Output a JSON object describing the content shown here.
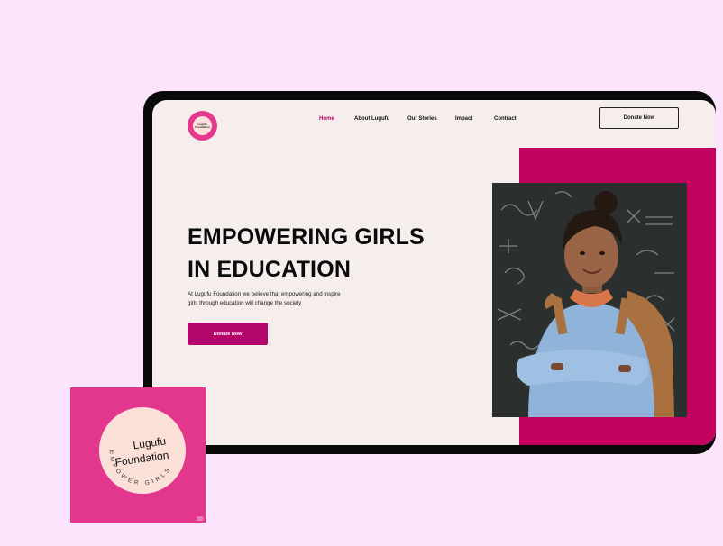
{
  "brand": {
    "name_line1": "Lugufu",
    "name_line2": "Foundation",
    "tagline": "EMPOWER GIRLS",
    "colors": {
      "accent": "#b3056a",
      "panel": "#c1035f",
      "card": "#e2378c",
      "background": "#fde4fd",
      "screen": "#f5eeec"
    }
  },
  "nav": {
    "items": [
      "Home",
      "About Lugufu",
      "Our Stories",
      "Impact",
      "Contract"
    ],
    "active": "Home",
    "cta": "Donate Now"
  },
  "hero": {
    "headline_line1": "EMPOWERING GIRLS",
    "headline_line2": "IN EDUCATION",
    "lead_line1": "At Lugufu Foundation we believe that empowering and inspire",
    "lead_line2": "girls through education will change the society",
    "cta": "Donate Now"
  },
  "icons": [
    "lugufu-logo-icon",
    "student-photo"
  ]
}
